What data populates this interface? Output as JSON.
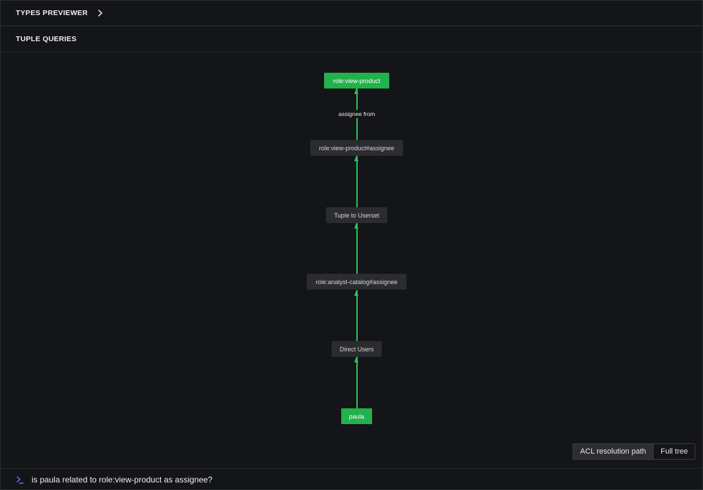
{
  "sections": {
    "types_previewer": "TYPES PREVIEWER",
    "tuple_queries": "TUPLE QUERIES"
  },
  "graph": {
    "nodes": {
      "top": "role:view-product",
      "assignee_userset": "role:view-product#assignee",
      "tuple_to_userset": "Tuple to Userset",
      "analyst_catalog": "role:analyst-catalog#assignee",
      "direct_users": "Direct Users",
      "user": "paula"
    },
    "edge_label": "assignee from",
    "accent_color": "#22b14c"
  },
  "view_toggle": {
    "acl_path": "ACL resolution path",
    "full_tree": "Full tree",
    "selected": "ACL resolution path"
  },
  "query": {
    "value": "is paula related to role:view-product as assignee?"
  }
}
